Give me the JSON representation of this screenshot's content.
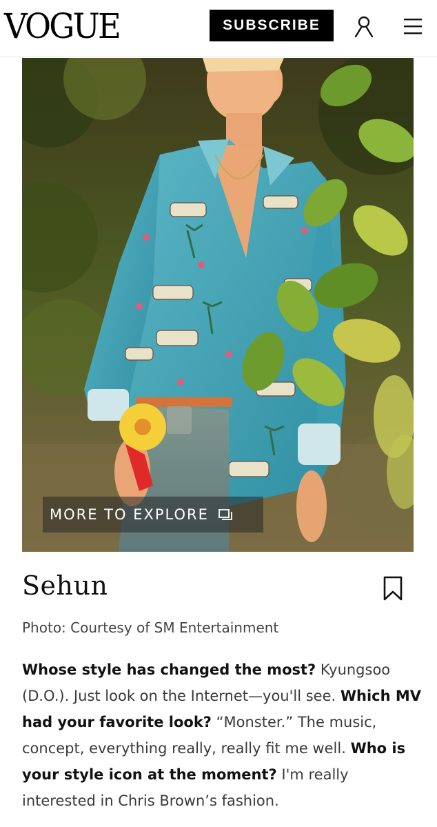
{
  "header": {
    "logo": "VOGUE",
    "subscribe_label": "SUBSCRIBE",
    "account_icon": "person-icon",
    "menu_icon": "hamburger-menu-icon"
  },
  "hero": {
    "explore_label": "MORE TO EXPLORE",
    "explore_icon": "gallery-icon"
  },
  "article": {
    "name": "Sehun",
    "bookmark_icon": "bookmark-icon",
    "credit": "Photo: Courtesy of SM Entertainment",
    "paragraph": [
      {
        "q": "Whose style has changed the most?",
        "a": " Kyungsoo (D.O.). Just look on the Internet—you'll see. "
      },
      {
        "q": "Which MV had your favorite look?",
        "a": " “Monster.” The music, concept, everything really, really fit me well. "
      },
      {
        "q": "Who is your style icon at the moment?",
        "a": " I'm really interested in Chris Brown’s fashion."
      }
    ]
  },
  "colors": {
    "brand": "#000000",
    "shirt": "#4aa6b8",
    "foliage": "#5f7d2a"
  }
}
